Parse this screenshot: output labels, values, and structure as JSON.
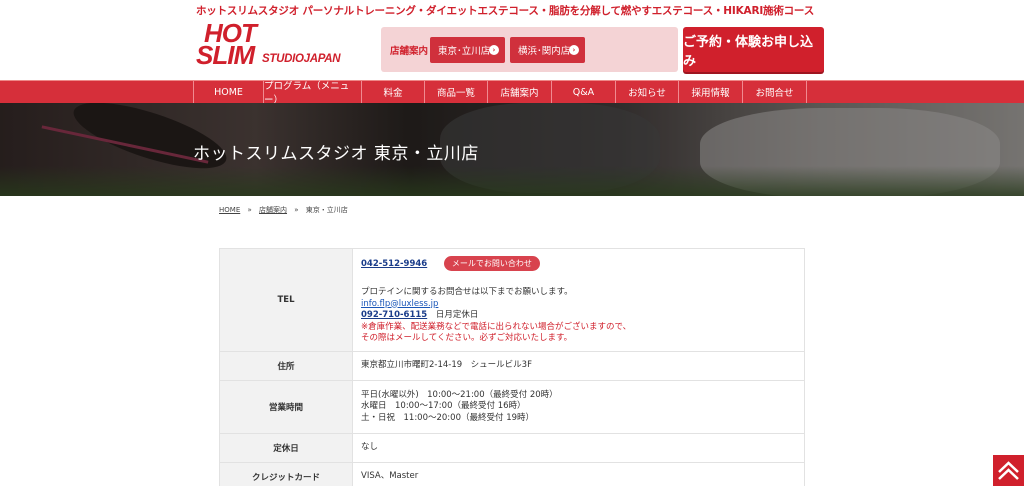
{
  "header": {
    "tagline": "ホットスリムスタジオ パーソナルトレーニング・ダイエットエステコース・脂肪を分解して燃やすエステコース・HIKARI施術コース",
    "logo": {
      "hot": "HOT",
      "slim": "SLIM",
      "studio": "STUDIOJAPAN"
    },
    "store_label": "店舗案内",
    "stores": [
      {
        "label": "東京･立川店",
        "icon": "chevron-right-icon"
      },
      {
        "label": "横浜･関内店",
        "icon": "chevron-right-icon"
      }
    ],
    "cta_label": "ご予約・体験お申し込み"
  },
  "nav": {
    "items": [
      "HOME",
      "プログラム（メニュー）",
      "料金",
      "商品一覧",
      "店舗案内",
      "Q&A",
      "お知らせ",
      "採用情報",
      "お問合せ"
    ]
  },
  "hero": {
    "title": "ホットスリムスタジオ 東京・立川店"
  },
  "breadcrumb": {
    "home": "HOME",
    "stores": "店舗案内",
    "current": "東京・立川店",
    "sep": "»"
  },
  "table": {
    "tel": {
      "label": "TEL",
      "phone": "042-512-9946",
      "mail_button": "メールでお問い合わせ",
      "protein_note": "プロテインに関するお問合せは以下までお願いします。",
      "email": "info.flp@luxless.jp",
      "phone2": "092-710-6115",
      "phone2_note": "日月定休日",
      "warning1": "※倉庫作業、配送業務などで電話に出られない場合がございますので、",
      "warning2": "その際はメールしてください。必ずご対応いたします。"
    },
    "address": {
      "label": "住所",
      "value": "東京都立川市曙町2-14-19　シュールビル3F"
    },
    "hours": {
      "label": "営業時間",
      "line1": "平日(水曜以外)　10:00～21:00（最終受付 20時）",
      "line2": "水曜日　10:00～17:00（最終受付 16時）",
      "line3": "土・日祝　11:00～20:00（最終受付 19時）"
    },
    "closed": {
      "label": "定休日",
      "value": "なし"
    },
    "card": {
      "label": "クレジットカード",
      "value": "VISA、Master"
    }
  },
  "colors": {
    "brand": "#d0202c",
    "nav": "#d62f3a",
    "store_box": "#f4d3d5"
  },
  "to_top": {
    "icon": "chevron-up-icon"
  }
}
